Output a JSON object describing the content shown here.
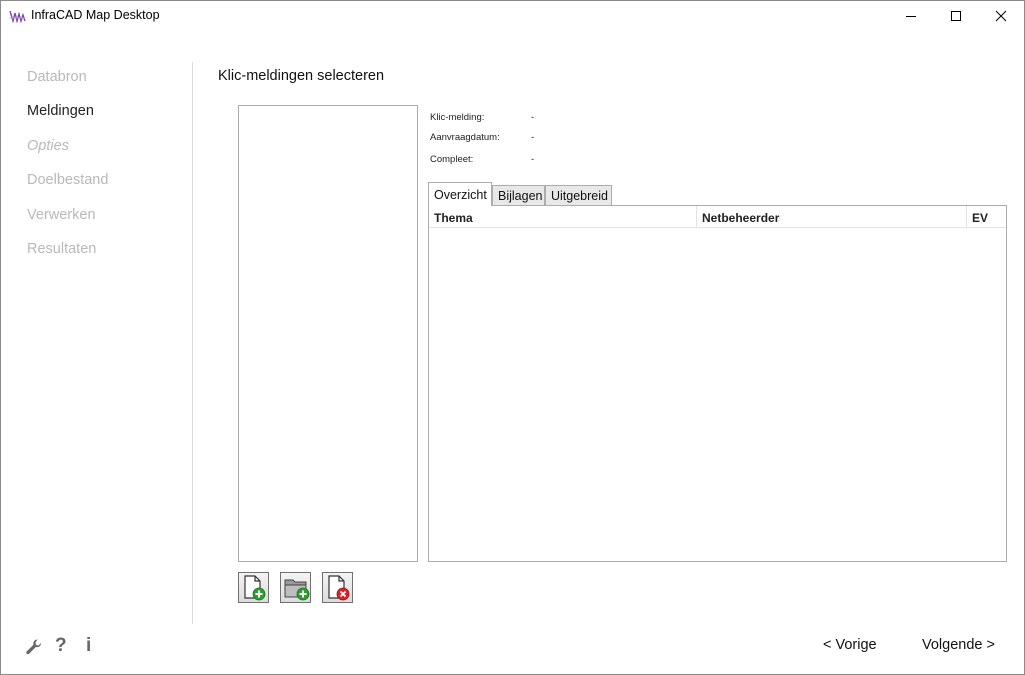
{
  "window": {
    "title": "InfraCAD Map Desktop"
  },
  "nav": {
    "items": [
      {
        "label": "Databron",
        "state": "disabled"
      },
      {
        "label": "Meldingen",
        "state": "active"
      },
      {
        "label": "Opties",
        "state": "disabled-italic"
      },
      {
        "label": "Doelbestand",
        "state": "disabled"
      },
      {
        "label": "Verwerken",
        "state": "disabled"
      },
      {
        "label": "Resultaten",
        "state": "disabled"
      }
    ]
  },
  "main": {
    "title": "Klic-meldingen selecteren",
    "info": [
      {
        "label": "Klic-melding:",
        "value": "-"
      },
      {
        "label": "Aanvraagdatum:",
        "value": "-"
      },
      {
        "label": "Compleet:",
        "value": "-"
      }
    ],
    "tabs": [
      {
        "label": "Overzicht",
        "selected": true
      },
      {
        "label": "Bijlagen",
        "selected": false
      },
      {
        "label": "Uitgebreid",
        "selected": false
      }
    ],
    "grid": {
      "columns": [
        "Thema",
        "Netbeheerder",
        "EV"
      ],
      "rows": []
    }
  },
  "toolbar": {
    "buttons": [
      {
        "icon": "add-file-icon"
      },
      {
        "icon": "add-folder-icon"
      },
      {
        "icon": "remove-file-icon"
      }
    ]
  },
  "footer": {
    "icons": [
      "wrench-icon",
      "help-icon",
      "info-icon"
    ],
    "help_glyph": "?",
    "info_glyph": "i",
    "prev_label": "< Vorige",
    "next_label": "Volgende >"
  },
  "colors": {
    "disabled_text": "#b9b9b9",
    "active_text": "#222222",
    "add_green": "#2e9e2e",
    "remove_red": "#d9232a"
  }
}
